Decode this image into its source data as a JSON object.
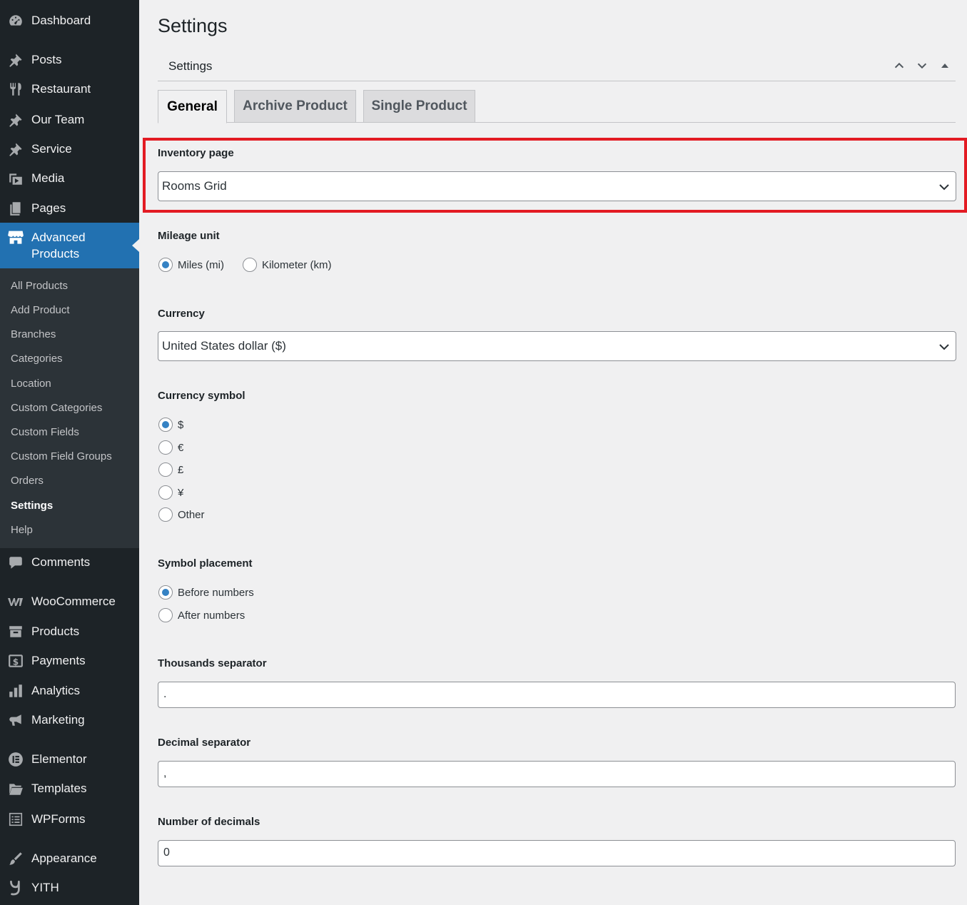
{
  "sidebar": {
    "menu": [
      {
        "label": "Dashboard",
        "icon": "dashboard-icon"
      },
      {
        "label": "Posts",
        "icon": "pin-icon"
      },
      {
        "label": "Restaurant",
        "icon": "food-icon"
      },
      {
        "label": "Our Team",
        "icon": "pin-icon"
      },
      {
        "label": "Service",
        "icon": "pin-icon"
      },
      {
        "label": "Media",
        "icon": "media-icon"
      },
      {
        "label": "Pages",
        "icon": "pages-icon"
      },
      {
        "label": "Advanced\nProducts",
        "icon": "store-icon"
      },
      {
        "label": "Comments",
        "icon": "comment-icon"
      },
      {
        "label": "WooCommerce",
        "icon": "woocommerce-icon"
      },
      {
        "label": "Products",
        "icon": "archive-icon"
      },
      {
        "label": "Payments",
        "icon": "payment-icon"
      },
      {
        "label": "Analytics",
        "icon": "chart-icon"
      },
      {
        "label": "Marketing",
        "icon": "megaphone-icon"
      },
      {
        "label": "Elementor",
        "icon": "elementor-icon"
      },
      {
        "label": "Templates",
        "icon": "folder-icon"
      },
      {
        "label": "WPForms",
        "icon": "forms-icon"
      },
      {
        "label": "Appearance",
        "icon": "brush-icon"
      },
      {
        "label": "YITH",
        "icon": "yith-icon"
      }
    ],
    "submenu": [
      "All Products",
      "Add Product",
      "Branches",
      "Categories",
      "Location",
      "Custom Categories",
      "Custom Fields",
      "Custom Field Groups",
      "Orders",
      "Settings",
      "Help"
    ]
  },
  "main": {
    "page_title": "Settings",
    "panel_title": "Settings",
    "tabs": [
      "General",
      "Archive Product",
      "Single Product"
    ],
    "fields": {
      "inventory_page": {
        "label": "Inventory page",
        "value": "Rooms Grid"
      },
      "mileage_unit": {
        "label": "Mileage unit",
        "options": [
          "Miles (mi)",
          "Kilometer (km)"
        ],
        "selected": "Miles (mi)"
      },
      "currency": {
        "label": "Currency",
        "value": "United States dollar ($)"
      },
      "currency_symbol": {
        "label": "Currency symbol",
        "options": [
          "$",
          "€",
          "£",
          "¥",
          "Other"
        ],
        "selected": "$"
      },
      "symbol_placement": {
        "label": "Symbol placement",
        "options": [
          "Before numbers",
          "After numbers"
        ],
        "selected": "Before numbers"
      },
      "thousands_separator": {
        "label": "Thousands separator",
        "value": "."
      },
      "decimal_separator": {
        "label": "Decimal separator",
        "value": ","
      },
      "number_of_decimals": {
        "label": "Number of decimals",
        "value": "0"
      }
    }
  },
  "colors": {
    "sidebar": "#1d2327",
    "active": "#2271b1",
    "highlight": "#e31b23",
    "radio_checked": "#3582c4"
  }
}
